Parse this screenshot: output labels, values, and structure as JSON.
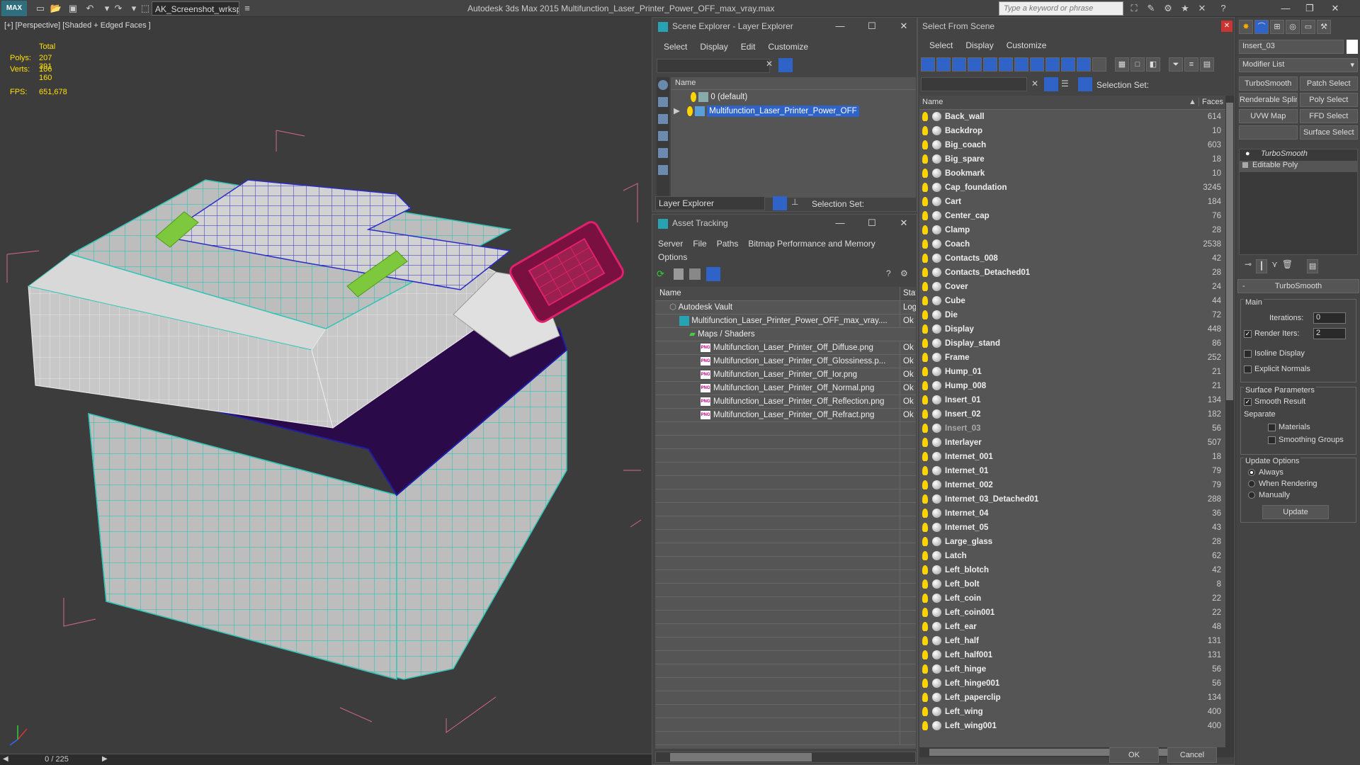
{
  "titlebar": {
    "logo": "MAX",
    "workspace": "AK_Screenshot_wrksp",
    "app_title": "Autodesk 3ds Max  2015    Multifunction_Laser_Printer_Power_OFF_max_vray.max",
    "search_placeholder": "Type a keyword or phrase"
  },
  "viewport": {
    "label": "[+] [Perspective] [Shaded + Edged Faces ]",
    "stats": {
      "total_label": "Total",
      "polys_label": "Polys:",
      "polys_value": "207 391",
      "verts_label": "Verts:",
      "verts_value": "106 160",
      "fps_label": "FPS:",
      "fps_value": "651,678"
    },
    "frame_counter": "0 / 225"
  },
  "scene_explorer": {
    "title": "Scene Explorer - Layer Explorer",
    "menu": [
      "Select",
      "Display",
      "Edit",
      "Customize"
    ],
    "column_name": "Name",
    "layers": [
      "0 (default)",
      "Multifunction_Laser_Printer_Power_OFF"
    ],
    "footer_dropdown": "Layer Explorer",
    "selection_set_label": "Selection Set:"
  },
  "asset_tracking": {
    "title": "Asset Tracking",
    "menu": [
      "Server",
      "File",
      "Paths",
      "Bitmap Performance and Memory"
    ],
    "menu_row2": "Options",
    "col_name": "Name",
    "col_status": "Stat",
    "rows": [
      {
        "name": "Autodesk Vault",
        "status": "Log",
        "indent": 0
      },
      {
        "name": "Multifunction_Laser_Printer_Power_OFF_max_vray....",
        "status": "Ok",
        "indent": 1
      },
      {
        "name": "Maps / Shaders",
        "status": "",
        "indent": 2
      },
      {
        "name": "Multifunction_Laser_Printer_Off_Diffuse.png",
        "status": "Ok",
        "indent": 3
      },
      {
        "name": "Multifunction_Laser_Printer_Off_Glossiness.p...",
        "status": "Ok",
        "indent": 3
      },
      {
        "name": "Multifunction_Laser_Printer_Off_Ior.png",
        "status": "Ok",
        "indent": 3
      },
      {
        "name": "Multifunction_Laser_Printer_Off_Normal.png",
        "status": "Ok",
        "indent": 3
      },
      {
        "name": "Multifunction_Laser_Printer_Off_Reflection.png",
        "status": "Ok",
        "indent": 3
      },
      {
        "name": "Multifunction_Laser_Printer_Off_Refract.png",
        "status": "Ok",
        "indent": 3
      }
    ]
  },
  "select_from_scene": {
    "title": "Select From Scene",
    "menu": [
      "Select",
      "Display",
      "Customize"
    ],
    "selection_set_label": "Selection Set:",
    "col_name": "Name",
    "col_faces": "Faces",
    "ok_label": "OK",
    "cancel_label": "Cancel",
    "objects": [
      {
        "name": "Back_wall",
        "faces": "614"
      },
      {
        "name": "Backdrop",
        "faces": "10"
      },
      {
        "name": "Big_coach",
        "faces": "603"
      },
      {
        "name": "Big_spare",
        "faces": "18"
      },
      {
        "name": "Bookmark",
        "faces": "10"
      },
      {
        "name": "Cap_foundation",
        "faces": "3245"
      },
      {
        "name": "Cart",
        "faces": "184"
      },
      {
        "name": "Center_cap",
        "faces": "76"
      },
      {
        "name": "Clamp",
        "faces": "28"
      },
      {
        "name": "Coach",
        "faces": "2538"
      },
      {
        "name": "Contacts_008",
        "faces": "42"
      },
      {
        "name": "Contacts_Detached01",
        "faces": "28"
      },
      {
        "name": "Cover",
        "faces": "24"
      },
      {
        "name": "Cube",
        "faces": "44"
      },
      {
        "name": "Die",
        "faces": "72"
      },
      {
        "name": "Display",
        "faces": "448"
      },
      {
        "name": "Display_stand",
        "faces": "86"
      },
      {
        "name": "Frame",
        "faces": "252"
      },
      {
        "name": "Hump_01",
        "faces": "21"
      },
      {
        "name": "Hump_008",
        "faces": "21"
      },
      {
        "name": "Insert_01",
        "faces": "134"
      },
      {
        "name": "Insert_02",
        "faces": "182"
      },
      {
        "name": "Insert_03",
        "faces": "56"
      },
      {
        "name": "Interlayer",
        "faces": "507"
      },
      {
        "name": "Internet_001",
        "faces": "18"
      },
      {
        "name": "Internet_01",
        "faces": "79"
      },
      {
        "name": "Internet_002",
        "faces": "79"
      },
      {
        "name": "Internet_03_Detached01",
        "faces": "288"
      },
      {
        "name": "Internet_04",
        "faces": "36"
      },
      {
        "name": "Internet_05",
        "faces": "43"
      },
      {
        "name": "Large_glass",
        "faces": "28"
      },
      {
        "name": "Latch",
        "faces": "62"
      },
      {
        "name": "Left_blotch",
        "faces": "42"
      },
      {
        "name": "Left_bolt",
        "faces": "8"
      },
      {
        "name": "Left_coin",
        "faces": "22"
      },
      {
        "name": "Left_coin001",
        "faces": "22"
      },
      {
        "name": "Left_ear",
        "faces": "48"
      },
      {
        "name": "Left_half",
        "faces": "131"
      },
      {
        "name": "Left_half001",
        "faces": "131"
      },
      {
        "name": "Left_hinge",
        "faces": "56"
      },
      {
        "name": "Left_hinge001",
        "faces": "56"
      },
      {
        "name": "Left_paperclip",
        "faces": "134"
      },
      {
        "name": "Left_wing",
        "faces": "400"
      },
      {
        "name": "Left_wing001",
        "faces": "400"
      }
    ]
  },
  "command_panel": {
    "object_name": "Insert_03",
    "modifier_list": "Modifier List",
    "buttons": [
      "TurboSmooth",
      "Patch Select",
      "Renderable Spline",
      "Poly Select",
      "UVW Map",
      "FFD Select",
      "",
      "Surface Select"
    ],
    "stack": [
      "TurboSmooth",
      "Editable Poly"
    ],
    "rollout_title": "TurboSmooth",
    "main_label": "Main",
    "iterations_label": "Iterations:",
    "iterations_value": "0",
    "render_iters_label": "Render Iters:",
    "render_iters_value": "2",
    "isoline_label": "Isoline Display",
    "explicit_normals_label": "Explicit Normals",
    "surface_params_label": "Surface Parameters",
    "smooth_result_label": "Smooth Result",
    "separate_label": "Separate",
    "materials_label": "Materials",
    "smoothing_groups_label": "Smoothing Groups",
    "update_options_label": "Update Options",
    "always_label": "Always",
    "when_rendering_label": "When Rendering",
    "manually_label": "Manually",
    "update_button": "Update"
  }
}
